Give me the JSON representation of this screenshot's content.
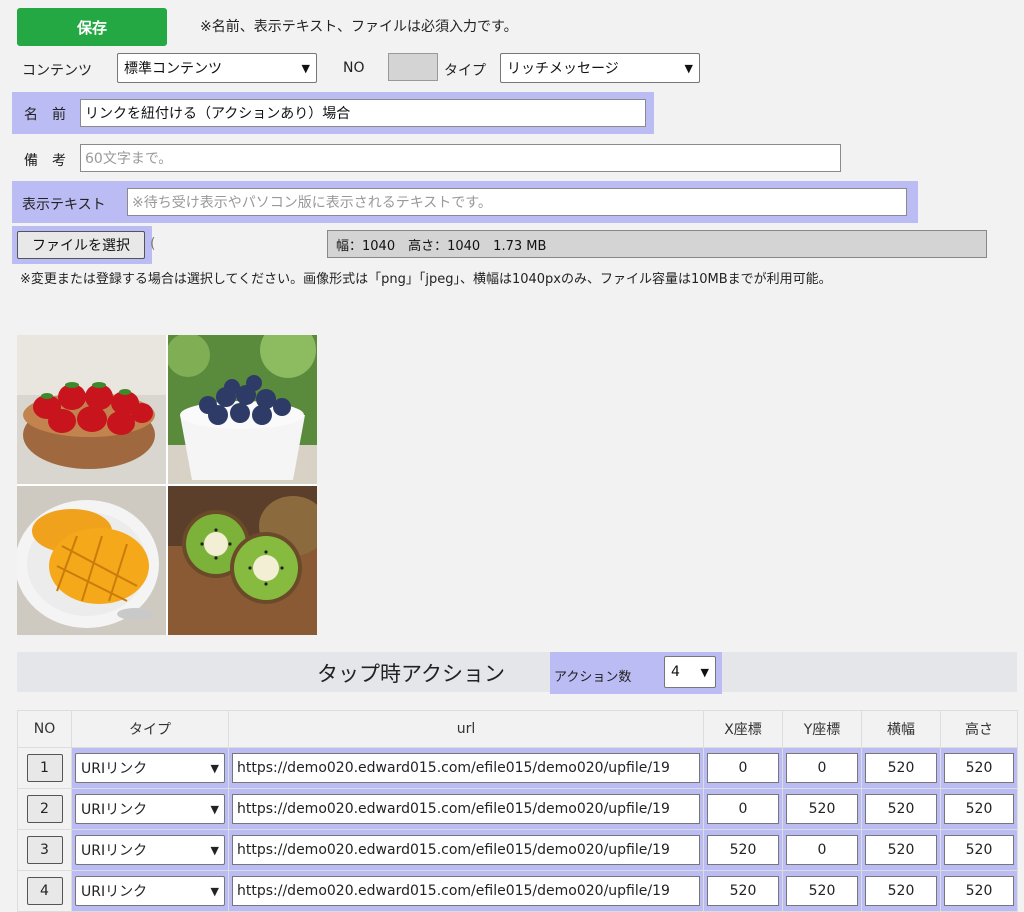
{
  "toolbar": {
    "save_label": "保存",
    "required_note": "※名前、表示テキスト、ファイルは必須入力です。"
  },
  "meta": {
    "contents_label": "コンテンツ",
    "contents_value": "標準コンテンツ",
    "no_label": "NO",
    "no_value": "",
    "type_label": "タイプ",
    "type_value": "リッチメッセージ"
  },
  "form": {
    "name_label": "名　前",
    "name_value": "リンクを紐付ける（アクションあり）場合",
    "remarks_label": "備　考",
    "remarks_placeholder": "60文字まで。",
    "display_text_label": "表示テキスト",
    "display_text_placeholder": "※待ち受け表示やパソコン版に表示されるテキストです。"
  },
  "file": {
    "choose_label": "ファイルを選択",
    "info": "幅：1040　高さ：1040　1.73 MB",
    "note": "※変更または登録する場合は選択してください。画像形式は「png」「jpeg」、横幅は1040pxのみ、ファイル容量は10MBまでが利用可能。"
  },
  "actions": {
    "title": "タップ時アクション",
    "count_label": "アクション数",
    "count_value": "4",
    "columns": [
      "NO",
      "タイプ",
      "url",
      "X座標",
      "Y座標",
      "横幅",
      "高さ"
    ],
    "rows": [
      {
        "no": "1",
        "type": "URIリンク",
        "url": "https://demo020.edward015.com/efile015/demo020/upfile/19",
        "x": "0",
        "y": "0",
        "w": "520",
        "h": "520"
      },
      {
        "no": "2",
        "type": "URIリンク",
        "url": "https://demo020.edward015.com/efile015/demo020/upfile/19",
        "x": "0",
        "y": "520",
        "w": "520",
        "h": "520"
      },
      {
        "no": "3",
        "type": "URIリンク",
        "url": "https://demo020.edward015.com/efile015/demo020/upfile/19",
        "x": "520",
        "y": "0",
        "w": "520",
        "h": "520"
      },
      {
        "no": "4",
        "type": "URIリンク",
        "url": "https://demo020.edward015.com/efile015/demo020/upfile/19",
        "x": "520",
        "y": "520",
        "w": "520",
        "h": "520"
      }
    ]
  },
  "colors": {
    "save_green": "#23a843",
    "highlight": "#bcbcf5"
  }
}
